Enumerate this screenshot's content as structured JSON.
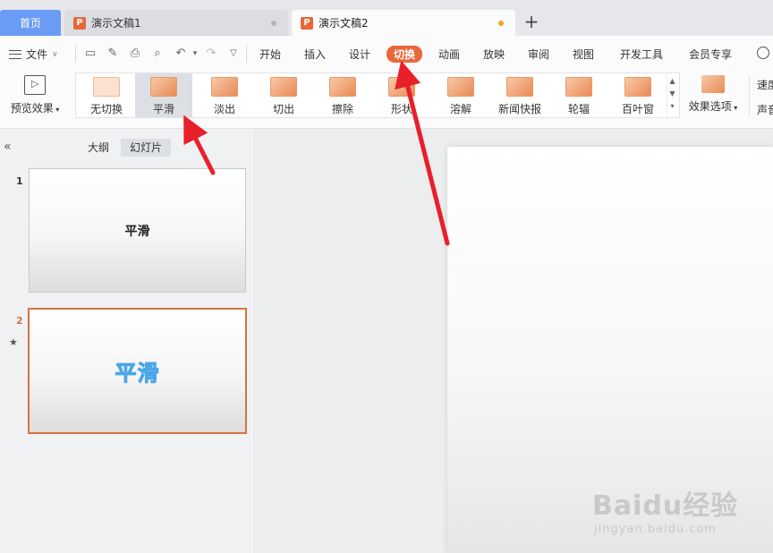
{
  "tabs": {
    "home": "首页",
    "doc1": "演示文稿1",
    "doc2": "演示文稿2",
    "doc_icon_letter": "P"
  },
  "menu": {
    "file": "文件",
    "items": [
      "开始",
      "插入",
      "设计",
      "切换",
      "动画",
      "放映",
      "审阅",
      "视图",
      "开发工具",
      "会员专享"
    ],
    "active": "切换"
  },
  "toolbar": {
    "preview": "预览效果",
    "gallery": [
      "无切换",
      "平滑",
      "淡出",
      "切出",
      "擦除",
      "形状",
      "溶解",
      "新闻快报",
      "轮辐",
      "百叶窗"
    ],
    "selected": "平滑",
    "effects": "效果选项",
    "speed": "速度",
    "sound": "声音"
  },
  "panel": {
    "outline_tab": "大纲",
    "slides_tab": "幻灯片",
    "slides": [
      {
        "number": "1",
        "title": "平滑"
      },
      {
        "number": "2",
        "title": "平滑"
      }
    ]
  },
  "watermark": {
    "main": "Baidu经验",
    "sub": "jingyan.baidu.com"
  },
  "colors": {
    "accent": "#e8683b",
    "home_tab": "#6b9cf5",
    "arrow": "#e8202a"
  }
}
